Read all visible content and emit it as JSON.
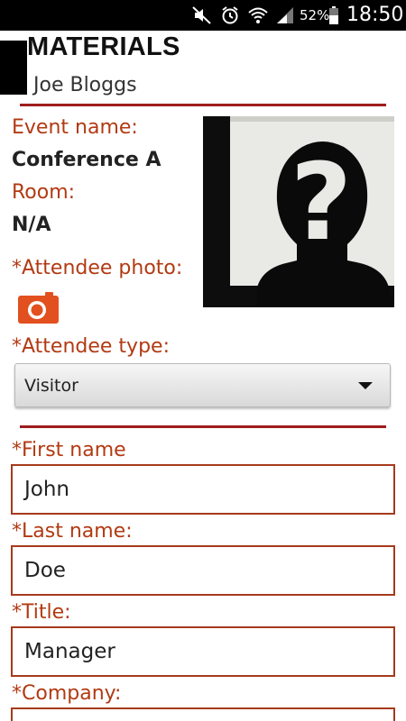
{
  "status_bar": {
    "battery_percent": "52%",
    "time": "18:50",
    "icons": [
      "mute-icon",
      "alarm-icon",
      "wifi-icon",
      "signal-icon",
      "battery-icon"
    ]
  },
  "header": {
    "title": "MATERIALS",
    "user_name": "Joe Bloggs"
  },
  "event": {
    "event_name_label": "Event name:",
    "event_name_value": "Conference A",
    "room_label": "Room:",
    "room_value": "N/A"
  },
  "attendee": {
    "photo_label": "*Attendee photo:",
    "photo_icon": "camera-icon",
    "type_label": "*Attendee type:",
    "type_value": "Visitor"
  },
  "form": {
    "first_name_label": "*First name",
    "first_name_value": "John",
    "last_name_label": "*Last name:",
    "last_name_value": "Doe",
    "title_label": "*Title:",
    "title_value": "Manager",
    "company_label": "*Company:",
    "company_value": ""
  },
  "colors": {
    "accent": "#b23a12",
    "divider": "#9e1c1c",
    "camera_button": "#e2501f",
    "status_bar": "#000000"
  }
}
